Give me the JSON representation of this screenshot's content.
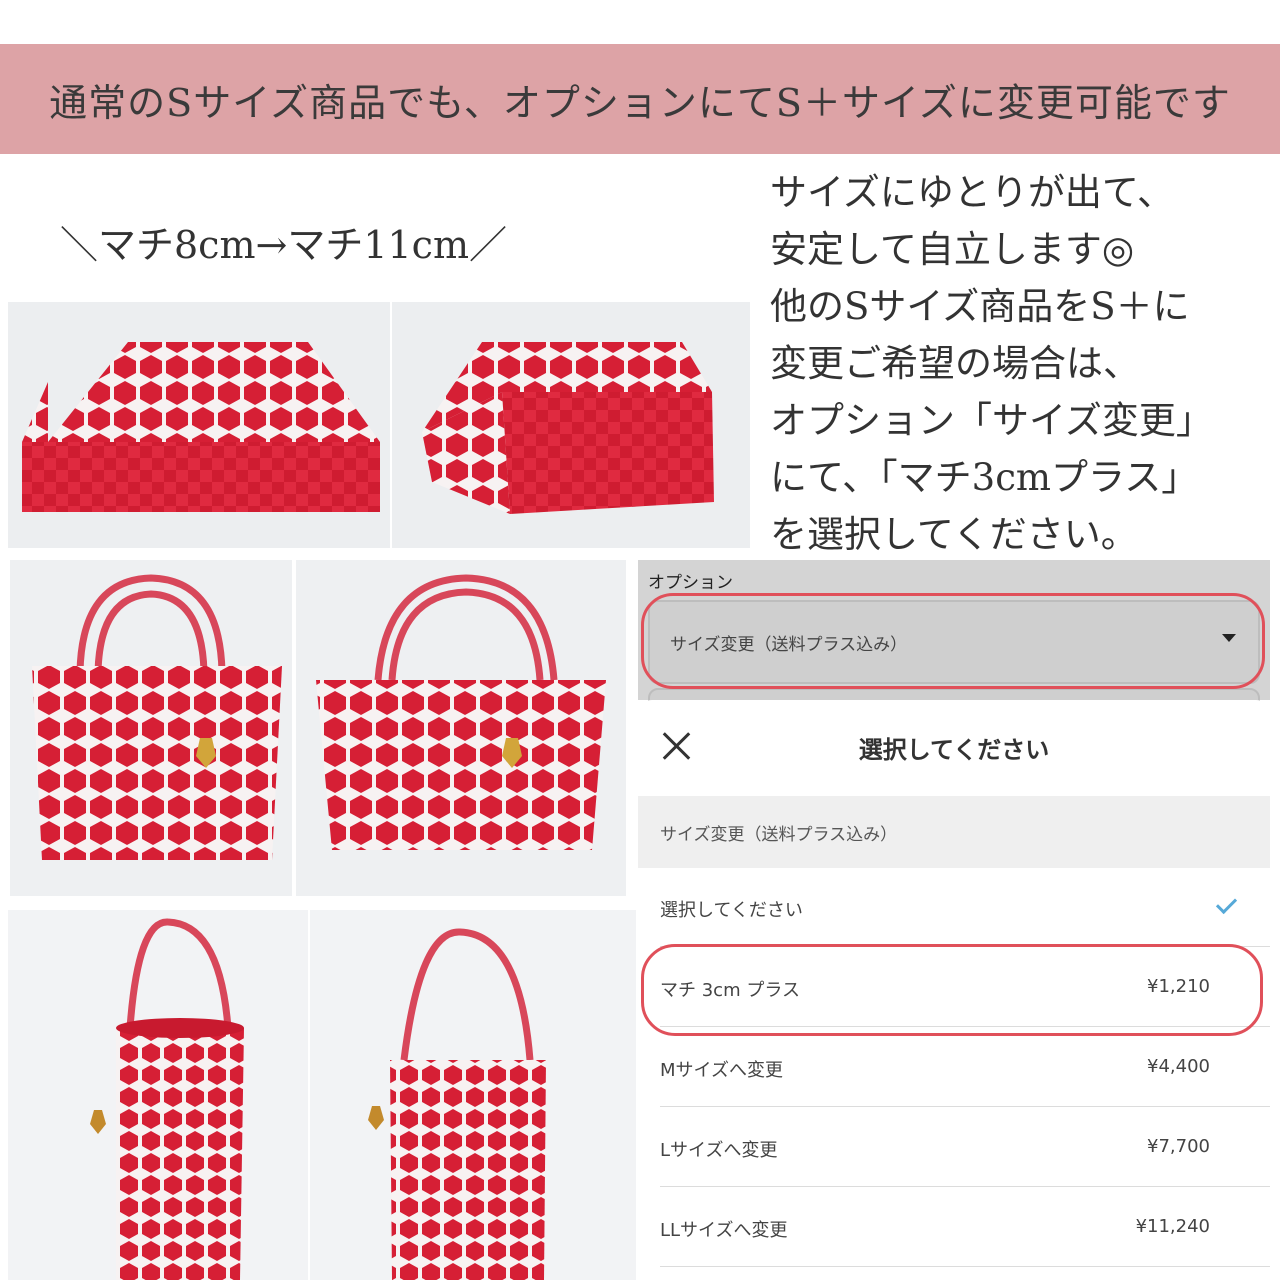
{
  "banner": "通常のSサイズ商品でも、オプションにてS＋サイズに変更可能です",
  "gusset_caption": "＼マチ8cm→マチ11cm／",
  "description_lines": [
    "サイズにゆとりが出て、",
    "安定して自立します◎",
    "他のSサイズ商品をS＋に",
    "変更ご希望の場合は、",
    "オプション「サイズ変更」",
    "にて、「マチ3cmプラス」",
    "を選択してください。"
  ],
  "option_form": {
    "label": "オプション",
    "selected": "サイズ変更（送料プラス込み）"
  },
  "picker": {
    "title": "選択してください",
    "group": "サイズ変更（送料プラス込み）",
    "items": [
      {
        "label": "選択してください",
        "price": ""
      },
      {
        "label": "マチ 3cm プラス",
        "price": "¥1,210"
      },
      {
        "label": "Mサイズへ変更",
        "price": "¥4,400"
      },
      {
        "label": "Lサイズへ変更",
        "price": "¥7,700"
      },
      {
        "label": "LLサイズへ変更",
        "price": "¥11,240"
      }
    ]
  },
  "colors": {
    "banner": "#dda3a6",
    "bag_red": "#d61f35",
    "highlight_ring": "#e0505a",
    "check": "#56a9d8"
  }
}
